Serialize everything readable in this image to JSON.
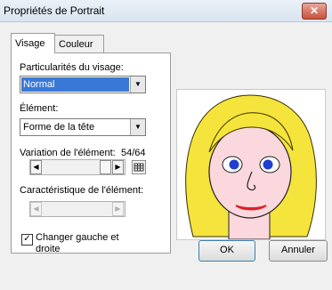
{
  "window": {
    "title": "Propriétés de Portrait",
    "close_glyph": "✕"
  },
  "tabs": [
    {
      "label": "Visage",
      "active": true
    },
    {
      "label": "Couleur",
      "active": false
    }
  ],
  "visage": {
    "particularites_label": "Particularités du visage:",
    "particularites_value": "Normal",
    "element_label": "Élément:",
    "element_value": "Forme de la tête",
    "variation_label": "Variation de l'élément:",
    "variation_value": "54/64",
    "caracteristique_label": "Caractéristique de l'élément:",
    "changer_checked": true,
    "changer_line1": "Changer gauche et",
    "changer_line2": "droite"
  },
  "buttons": {
    "ok": "OK",
    "cancel": "Annuler"
  },
  "colors": {
    "hair": "#f5e43c",
    "skin": "#fad8de",
    "eyes": "#1f3fd0",
    "mouth": "#e01e2a",
    "selection": "#3a78d6"
  }
}
